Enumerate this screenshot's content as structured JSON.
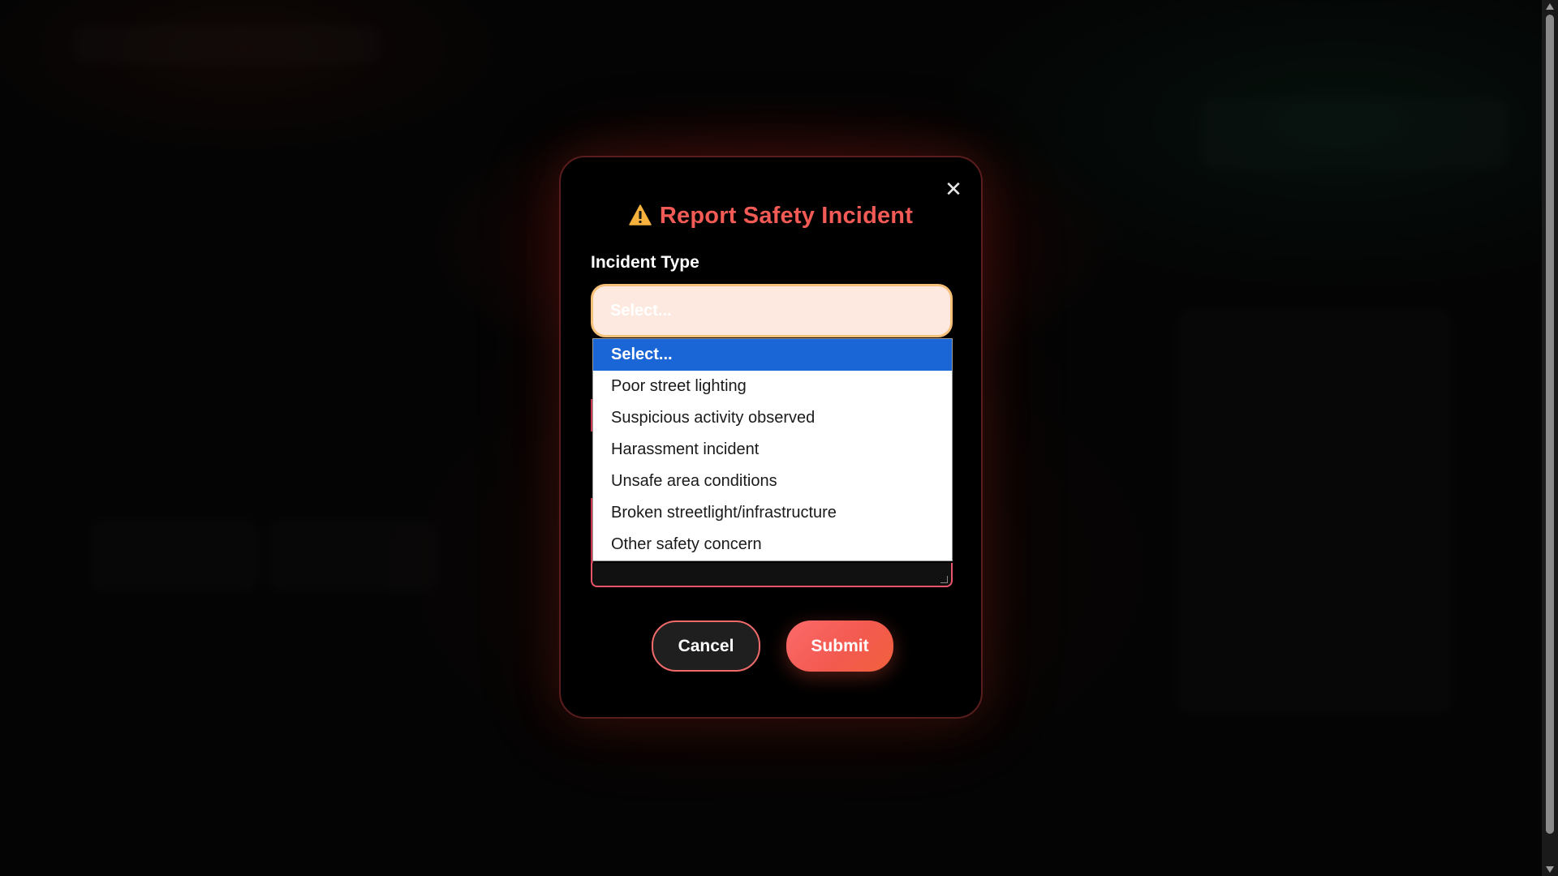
{
  "modal": {
    "title": "Report Safety Incident",
    "title_icon": "warning-icon",
    "close_label": "✕",
    "incident_type": {
      "label": "Incident Type",
      "selected_value": "Select...",
      "options": [
        "Select...",
        "Poor street lighting",
        "Suspicious activity observed",
        "Harassment incident",
        "Unsafe area conditions",
        "Broken streetlight/infrastructure",
        "Other safety concern"
      ],
      "highlighted_index": 0
    },
    "buttons": {
      "cancel_label": "Cancel",
      "submit_label": "Submit"
    }
  },
  "colors": {
    "accent": "#f25b55",
    "select_background": "#fde9df",
    "select_border": "#f6c07a",
    "option_highlight": "#1a66d6"
  }
}
